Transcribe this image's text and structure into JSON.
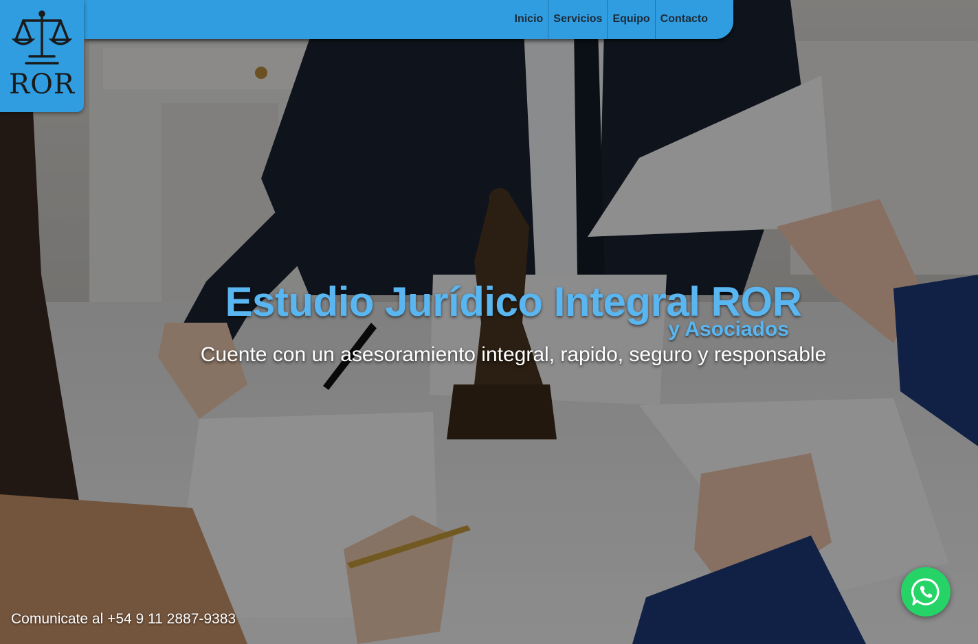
{
  "logo": {
    "text": "ROR",
    "icon": "scales-of-justice-icon"
  },
  "nav": {
    "items": [
      {
        "label": "Inicio"
      },
      {
        "label": "Servicios"
      },
      {
        "label": "Equipo"
      },
      {
        "label": "Contacto"
      }
    ]
  },
  "hero": {
    "title": "Estudio Jurídico Integral ROR",
    "subtitle": "y Asociados",
    "tagline": "Cuente con un asesoramiento integral, rapido, seguro y responsable"
  },
  "contact": {
    "text": "Comunicate al +54 9 11 2887-9383"
  },
  "whatsapp": {
    "icon": "whatsapp-icon"
  },
  "colors": {
    "brand_blue": "#2f9de0",
    "headline_blue": "#59b6f0",
    "whatsapp_green": "#25d366"
  }
}
